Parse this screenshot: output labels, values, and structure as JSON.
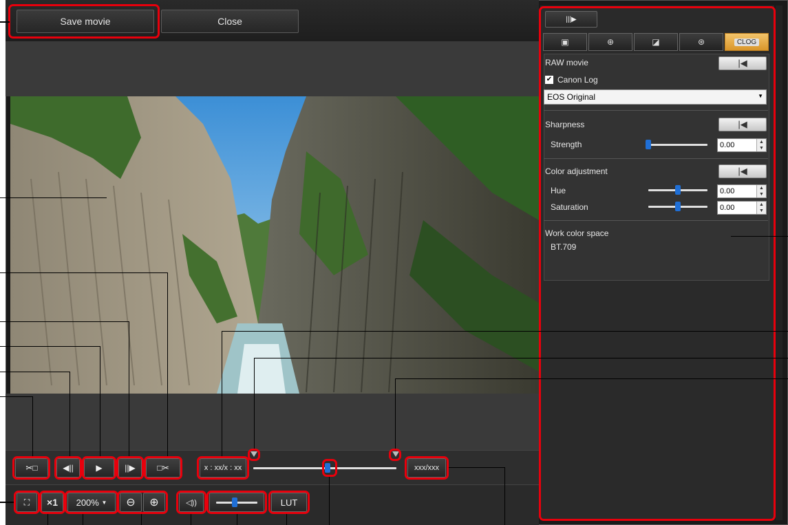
{
  "top_buttons": {
    "save": "Save movie",
    "close": "Close"
  },
  "playback": {
    "time_display": "x : xx/x : xx",
    "frame_display": "xxx/xxx",
    "zoom_value": "200%",
    "speed_label": "×1",
    "lut_label": "LUT"
  },
  "icons": {
    "cut_start": "✂□",
    "prev_frame": "◀||",
    "play": "▶",
    "next_frame": "||▶",
    "cut_end": "□✂",
    "zoom_out": "⊖",
    "zoom_in": "⊕",
    "volume": "◁))",
    "fullscreen": "⛶",
    "dropdown": "▼",
    "reset": "|◀",
    "panel_toggle": "|||▶"
  },
  "panel": {
    "tabs": [
      "▣",
      "⊕",
      "◪",
      "⊛",
      "CLOG"
    ],
    "active_tab": 4,
    "raw_movie": "RAW movie",
    "canon_log_checkbox": "Canon Log",
    "canon_log_checked": true,
    "log_select_value": "EOS Original",
    "sharpness": "Sharpness",
    "strength_label": "Strength",
    "strength_value": "0.00",
    "strength_level": 0.0,
    "color_adjustment": "Color adjustment",
    "hue_label": "Hue",
    "hue_value": "0.00",
    "hue_level": 0.5,
    "saturation_label": "Saturation",
    "saturation_value": "0.00",
    "saturation_level": 0.5,
    "work_color_space_label": "Work color space",
    "work_color_space_value": "BT.709"
  },
  "volume_level": 0.45,
  "seek_position": 0.52,
  "colors": {
    "highlight": "#e8000c",
    "slider_thumb": "#1f6fd6"
  }
}
